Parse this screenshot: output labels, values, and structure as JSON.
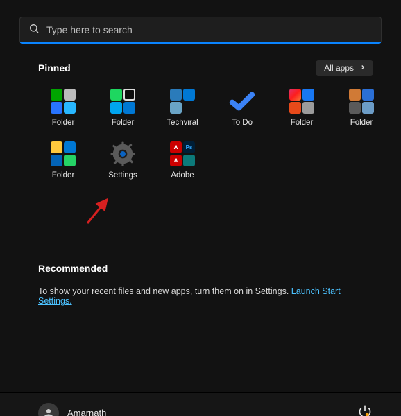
{
  "search": {
    "placeholder": "Type here to search"
  },
  "pinned": {
    "title": "Pinned",
    "all_apps_label": "All apps",
    "tiles": [
      {
        "label": "Folder"
      },
      {
        "label": "Folder"
      },
      {
        "label": "Techviral"
      },
      {
        "label": "To Do"
      },
      {
        "label": "Folder"
      },
      {
        "label": "Folder"
      },
      {
        "label": "Folder"
      },
      {
        "label": "Settings"
      },
      {
        "label": "Adobe"
      }
    ]
  },
  "recommended": {
    "title": "Recommended",
    "text": "To show your recent files and new apps, turn them on in Settings. ",
    "link_label": "Launch Start Settings."
  },
  "footer": {
    "username": "Amarnath"
  }
}
